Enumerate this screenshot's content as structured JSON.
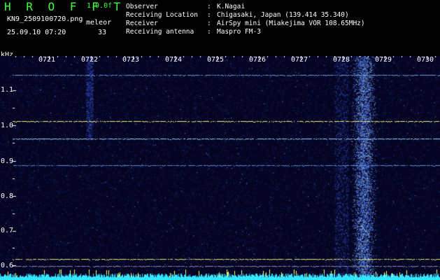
{
  "app": {
    "title": "H R O F F T",
    "version": "1.0.0f",
    "mode": "meleor",
    "count": "33"
  },
  "capture": {
    "filename": "KN9_2509100720.png",
    "datetime": "25.09.10 07:20"
  },
  "metadata": [
    {
      "key": "Observer",
      "value": "K.Nagai"
    },
    {
      "key": "Receiving Location",
      "value": "Chigasaki, Japan (139.414 35.340)"
    },
    {
      "key": "Receiver",
      "value": "AirSpy mini (Miakejima VOR 108.65MHz)"
    },
    {
      "key": "Receiving antenna",
      "value": "Maspro FM-3"
    }
  ],
  "y_axis": {
    "unit": "kHz",
    "ticks": [
      "1.1",
      "1.0",
      "0.9",
      "0.8",
      "0.7",
      "0.6"
    ],
    "minor": [
      "1.05",
      "0.95",
      "0.85",
      "0.75",
      "0.65"
    ]
  },
  "time_axis": {
    "labels": [
      "0721",
      "0722",
      "0723",
      "0724",
      "0725",
      "0726",
      "0727",
      "0728",
      "0729",
      "0730"
    ]
  },
  "colors": {
    "background": "#000000",
    "spectrogram": "#050523",
    "title_green": "#3cff3c",
    "signal_cyan": "#55ccff",
    "carrier_yellow": "#ffff66",
    "baseline_cyan": "#33e6ff"
  }
}
